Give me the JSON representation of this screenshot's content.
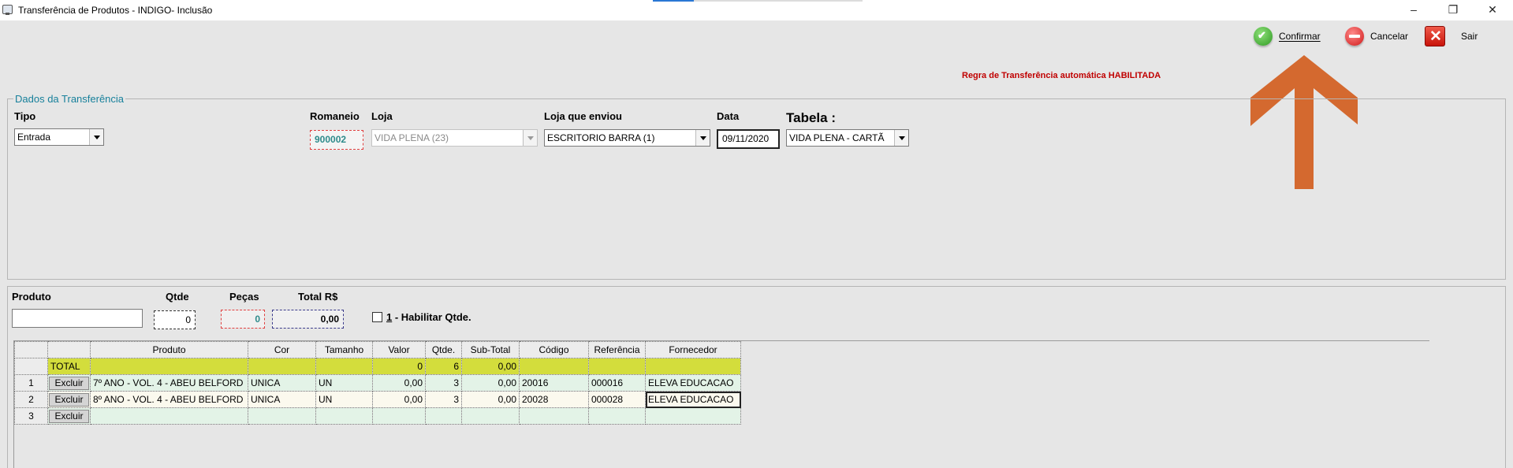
{
  "window": {
    "title": "Transferência de Produtos - INDIGO- Inclusão",
    "minimize": "–",
    "restore": "❐",
    "close": "✕"
  },
  "toolbar": {
    "confirm_label": "Confirmar",
    "cancel_label": "Cancelar",
    "exit_label": "Sair"
  },
  "rule_message": "Regra de Transferência automática HABILITADA",
  "dados": {
    "group_title": "Dados da Transferência",
    "tipo_label": "Tipo",
    "tipo_value": "Entrada",
    "romaneio_label": "Romaneio",
    "romaneio_value": "900002",
    "loja_label": "Loja",
    "loja_value": "VIDA PLENA (23)",
    "loja_envio_label": "Loja que enviou",
    "loja_envio_value": "ESCRITORIO BARRA (1)",
    "data_label": "Data",
    "data_value": "09/11/2020",
    "tabela_label": "Tabela :",
    "tabela_value": "VIDA PLENA - CARTÃ"
  },
  "entry": {
    "produto_label": "Produto",
    "produto_value": "",
    "qtde_label": "Qtde",
    "qtde_value": "0",
    "pecas_label": "Peças",
    "pecas_value": "0",
    "total_label": "Total R$",
    "total_value": "0,00",
    "habilitar_hotkey": "1",
    "habilitar_label": " - Habilitar Qtde."
  },
  "grid": {
    "columns": [
      "",
      "",
      "Produto",
      "Cor",
      "Tamanho",
      "Valor",
      "Qtde.",
      "Sub-Total",
      "Código",
      "Referência",
      "Fornecedor"
    ],
    "total_row": {
      "label": "TOTAL",
      "valor": "0",
      "qtde": "6",
      "subtotal": "0,00"
    },
    "excluir_label": "Excluir",
    "rows": [
      {
        "num": "1",
        "produto": "7º ANO - VOL. 4 - ABEU BELFORD",
        "cor": "UNICA",
        "tamanho": "UN",
        "valor": "0,00",
        "qtde": "3",
        "subtotal": "0,00",
        "codigo": "20016",
        "referencia": "000016",
        "fornecedor": "ELEVA EDUCACAO"
      },
      {
        "num": "2",
        "produto": "8º ANO - VOL. 4 - ABEU BELFORD",
        "cor": "UNICA",
        "tamanho": "UN",
        "valor": "0,00",
        "qtde": "3",
        "subtotal": "0,00",
        "codigo": "20028",
        "referencia": "000028",
        "fornecedor": "ELEVA EDUCACAO"
      },
      {
        "num": "3",
        "produto": "",
        "cor": "",
        "tamanho": "",
        "valor": "",
        "qtde": "",
        "subtotal": "",
        "codigo": "",
        "referencia": "",
        "fornecedor": ""
      }
    ]
  },
  "colors": {
    "accent_teal": "#17809b",
    "rule_red": "#c00000",
    "total_row": "#d3dd3c",
    "arrow": "#d4692f"
  }
}
